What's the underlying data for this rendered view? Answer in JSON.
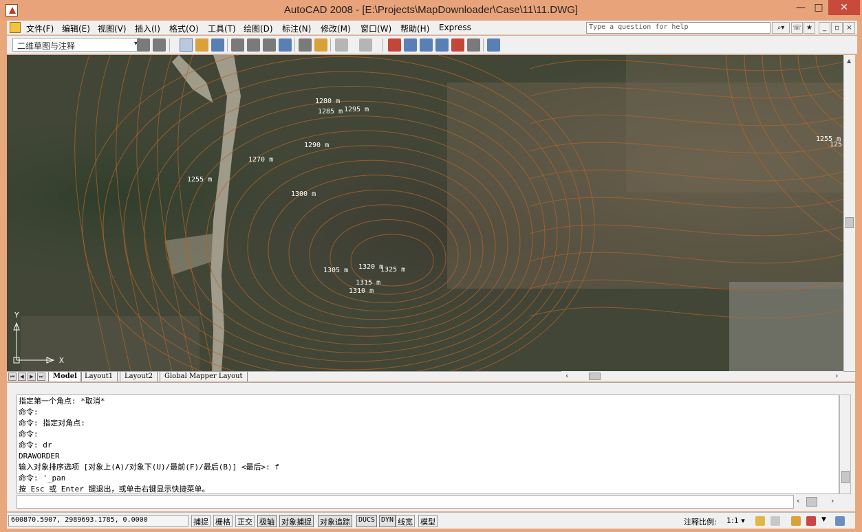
{
  "window": {
    "title": "AutoCAD 2008 - [E:\\Projects\\MapDownloader\\Case\\11\\11.DWG]",
    "minimize": "—",
    "maximize": "□",
    "close": "✕"
  },
  "menu": {
    "items": [
      "文件(F)",
      "编辑(E)",
      "视图(V)",
      "插入(I)",
      "格式(O)",
      "工具(T)",
      "绘图(D)",
      "标注(N)",
      "修改(M)",
      "窗口(W)",
      "帮助(H)",
      "Express"
    ],
    "help_placeholder": "Type a question for help",
    "doc_min": "_",
    "doc_restore": "▫",
    "doc_close": "×"
  },
  "toolbar": {
    "workspace": "二维草图与注释"
  },
  "map": {
    "contour_color": "#b5652a",
    "labels": [
      {
        "text": "1280 m"
      },
      {
        "text": "1285 m"
      },
      {
        "text": "1295 m"
      },
      {
        "text": "1290 m"
      },
      {
        "text": "1270 m"
      },
      {
        "text": "1255 m"
      },
      {
        "text": "1300 m"
      },
      {
        "text": "1305 m"
      },
      {
        "text": "1320 m"
      },
      {
        "text": "1325 m"
      },
      {
        "text": "1315 m"
      },
      {
        "text": "1310 m"
      },
      {
        "text": "1255 m"
      },
      {
        "text": "125"
      }
    ],
    "ucs": {
      "y": "Y",
      "x": "X"
    }
  },
  "layout_tabs": [
    "Model",
    "Layout1",
    "Layout2",
    "Global Mapper Layout"
  ],
  "command": {
    "lines": [
      "指定第一个角点: *取消*",
      "命令:",
      "命令: 指定对角点:",
      "命令:",
      "命令: dr",
      "DRAWORDER",
      "输入对象排序选项 [对象上(A)/对象下(U)/最前(F)/最后(B)] <最后>: f",
      "命令: '_pan",
      "按 Esc 或 Enter 键退出，或单击右键显示快捷菜单。"
    ]
  },
  "status": {
    "coords": "600870.5907, 2989693.1785, 0.0000",
    "toggles": [
      "捕捉",
      "栅格",
      "正交",
      "极轴",
      "对象捕捉",
      "对象追踪",
      "DUCS",
      "DYN",
      "线宽",
      "模型"
    ],
    "anno_label": "注释比例:",
    "anno_value": "1:1 ▾"
  }
}
